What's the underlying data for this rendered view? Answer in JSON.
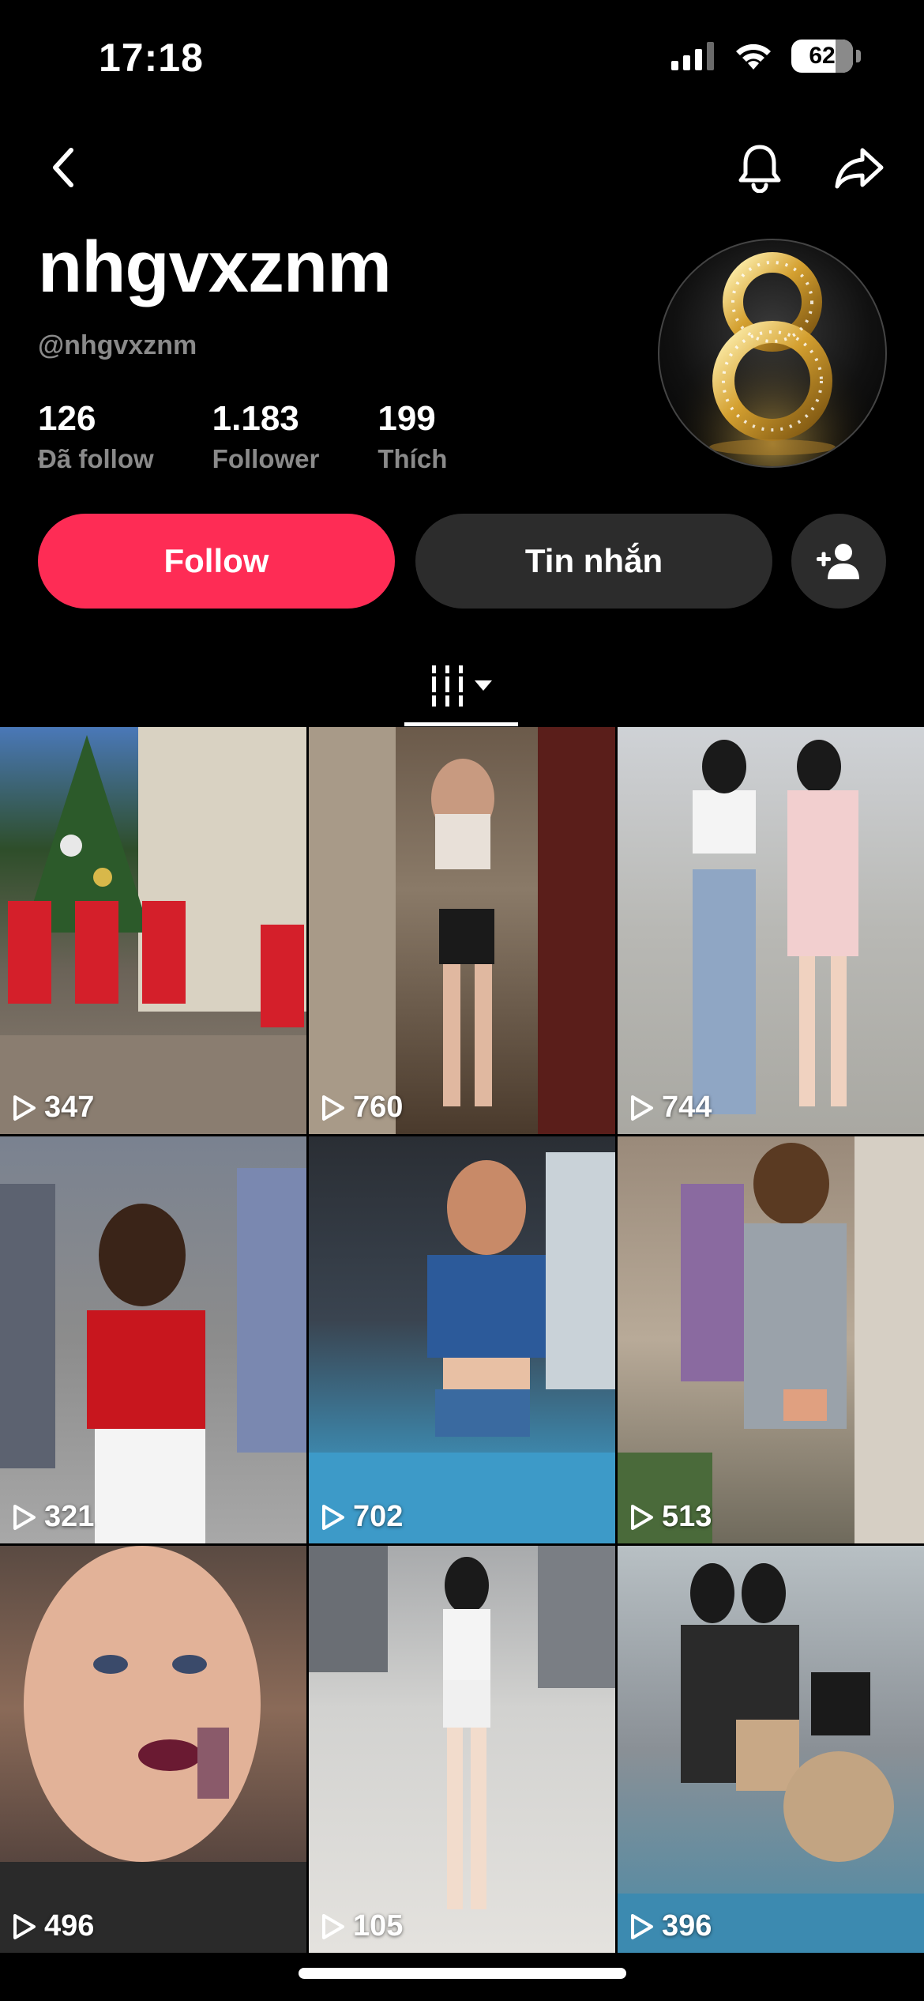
{
  "status_bar": {
    "time": "17:18",
    "battery": "62"
  },
  "profile": {
    "display_name": "nhgvxznm",
    "handle": "@nhgvxznm",
    "stats": [
      {
        "value": "126",
        "label": "Đã follow"
      },
      {
        "value": "1.183",
        "label": "Follower"
      },
      {
        "value": "199",
        "label": "Thích"
      }
    ]
  },
  "actions": {
    "follow_label": "Follow",
    "message_label": "Tin nhắn"
  },
  "videos": [
    {
      "views": "347"
    },
    {
      "views": "760"
    },
    {
      "views": "744"
    },
    {
      "views": "321"
    },
    {
      "views": "702"
    },
    {
      "views": "513"
    },
    {
      "views": "496"
    },
    {
      "views": "105"
    },
    {
      "views": "396"
    }
  ],
  "colors": {
    "accent": "#fe2c55",
    "button_dark": "#2c2c2c",
    "muted_text": "#8a8a8a"
  }
}
